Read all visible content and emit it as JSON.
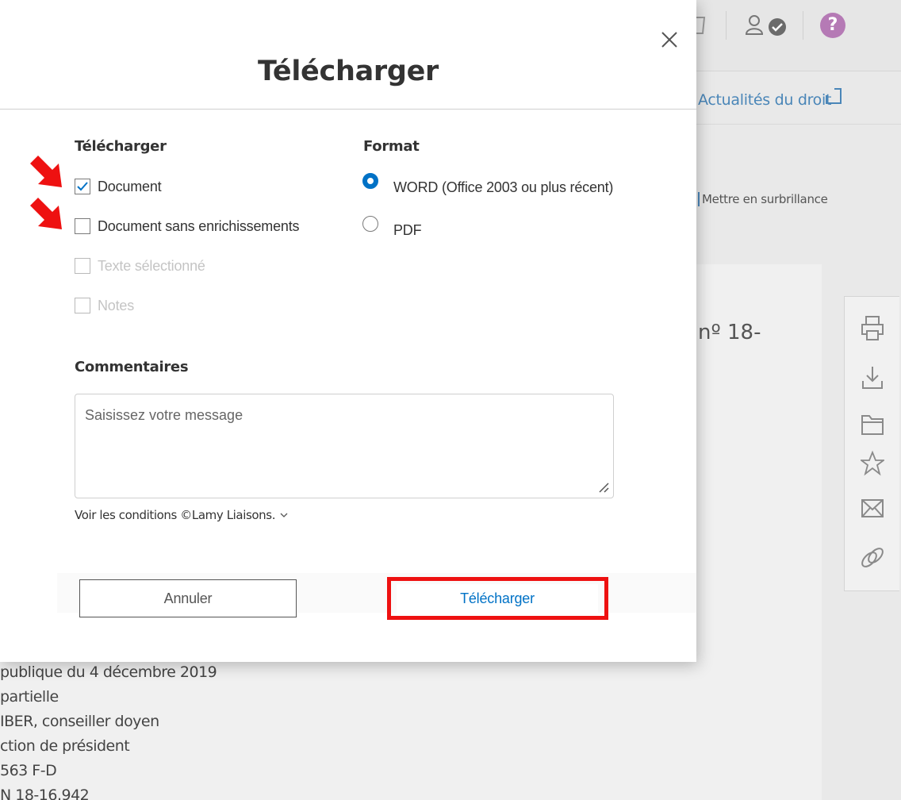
{
  "background": {
    "news_link": "Actualités du droit",
    "highlight_label": "Mettre en surbrillance",
    "doc_number": "nº 18-",
    "doc_lines": [
      "publique du 4 décembre 2019",
      "partielle",
      "IBER, conseiller doyen",
      "ction de président",
      "563 F-D",
      " N 18-16.942"
    ],
    "help_glyph": "?",
    "side_tools": [
      "print-icon",
      "download-icon",
      "folder-icon",
      "star-icon",
      "mail-icon",
      "link-icon"
    ]
  },
  "dialog": {
    "title": "Télécharger",
    "download_section": {
      "heading": "Télécharger",
      "options": [
        {
          "label": "Document",
          "checked": true,
          "disabled": false
        },
        {
          "label": "Document sans enrichissements",
          "checked": false,
          "disabled": false
        },
        {
          "label": "Texte sélectionné",
          "checked": false,
          "disabled": true
        },
        {
          "label": "Notes",
          "checked": false,
          "disabled": true
        }
      ]
    },
    "format_section": {
      "heading": "Format",
      "options": [
        {
          "label": "WORD (Office 2003 ou plus récent)",
          "selected": true
        },
        {
          "label": "PDF",
          "selected": false
        }
      ]
    },
    "comments": {
      "heading": "Commentaires",
      "placeholder": "Saisissez votre message",
      "value": ""
    },
    "conditions_link": "Voir les conditions ©Lamy Liaisons.",
    "cancel_label": "Annuler",
    "download_label": "Télécharger"
  },
  "colors": {
    "accent": "#0072c6",
    "annotation_red": "#ee1111",
    "help_purple": "#b57ab5"
  }
}
